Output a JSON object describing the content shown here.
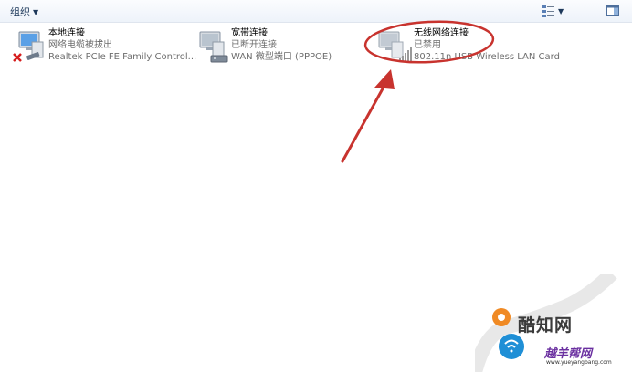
{
  "toolbar": {
    "organize_label": "组织",
    "view_icon": "view-options-icon",
    "pane_icon": "preview-pane-icon"
  },
  "connections": [
    {
      "name": "本地连接",
      "status": "网络电缆被拔出",
      "device": "Realtek PCIe FE Family Control...",
      "icon": "lan-adapter-disconnected-icon"
    },
    {
      "name": "宽带连接",
      "status": "已断开连接",
      "device": "WAN 微型端口 (PPPOE)",
      "icon": "broadband-adapter-icon"
    },
    {
      "name": "无线网络连接",
      "status": "已禁用",
      "device": "802.11n USB Wireless LAN Card",
      "icon": "wireless-adapter-disabled-icon"
    }
  ],
  "annotation": {
    "color": "#c8332e"
  },
  "watermark": {
    "brand_text": "酷知网",
    "site_name": "越羊帮网",
    "site_url": "www.yueyangbang.com"
  }
}
